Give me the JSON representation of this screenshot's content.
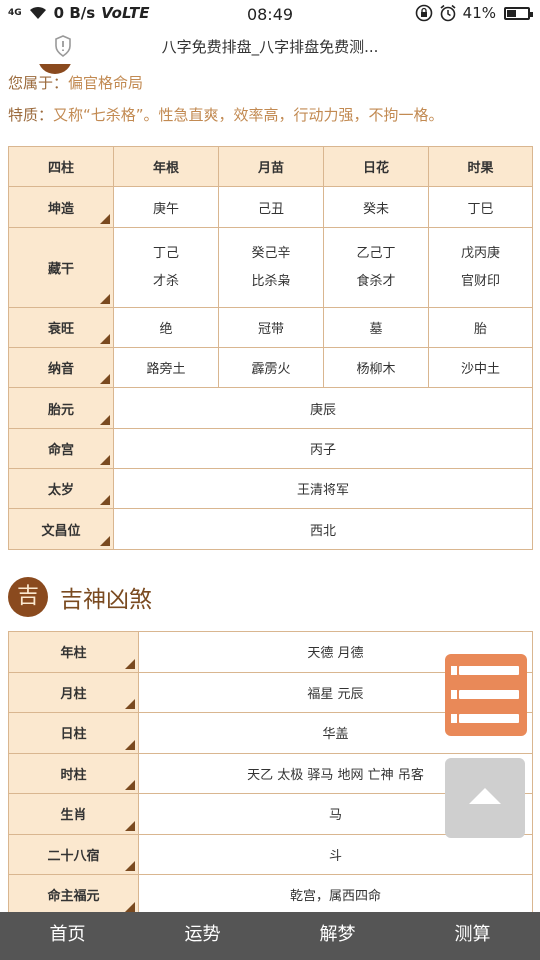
{
  "status_bar": {
    "signal": "4G",
    "speed": "0 B/s",
    "volte": "VoLTE",
    "time": "08:49",
    "battery": "41%",
    "battery_level": 0.41
  },
  "browser": {
    "title": "八字免费排盘_八字排盘免费测..."
  },
  "summary": {
    "belong_label": "您属于：",
    "belong_value": "偏官格命局",
    "trait_label": "特质：",
    "trait_value": "又称“七杀格”。性急直爽，效率高，行动力强，不拘一格。"
  },
  "bazi_table": {
    "headers": [
      "四柱",
      "年根",
      "月苗",
      "日花",
      "时果"
    ],
    "rows": [
      {
        "label": "坤造",
        "cells": [
          [
            "庚午"
          ],
          [
            "己丑"
          ],
          [
            "癸未"
          ],
          [
            "丁巳"
          ]
        ]
      },
      {
        "label": "藏干",
        "cells": [
          [
            "丁己",
            "才杀"
          ],
          [
            "癸己辛",
            "比杀枭"
          ],
          [
            "乙己丁",
            "食杀才"
          ],
          [
            "戊丙庚",
            "官财印"
          ]
        ]
      },
      {
        "label": "衰旺",
        "cells": [
          [
            "绝"
          ],
          [
            "冠带"
          ],
          [
            "墓"
          ],
          [
            "胎"
          ]
        ]
      },
      {
        "label": "纳音",
        "cells": [
          [
            "路旁土"
          ],
          [
            "霹雳火"
          ],
          [
            "杨柳木"
          ],
          [
            "沙中土"
          ]
        ]
      }
    ],
    "merged_rows": [
      {
        "label": "胎元",
        "value": "庚辰"
      },
      {
        "label": "命宫",
        "value": "丙子"
      },
      {
        "label": "太岁",
        "value": "王清将军"
      },
      {
        "label": "文昌位",
        "value": "西北"
      }
    ]
  },
  "section": {
    "icon_char": "吉",
    "title": "吉神凶煞"
  },
  "shensha_table": [
    {
      "label": "年柱",
      "value": "天德 月德"
    },
    {
      "label": "月柱",
      "value": "福星 元辰"
    },
    {
      "label": "日柱",
      "value": "华盖"
    },
    {
      "label": "时柱",
      "value": "天乙 太极 驿马 地网 亡神 吊客"
    },
    {
      "label": "生肖",
      "value": "马"
    },
    {
      "label": "二十八宿",
      "value": "斗"
    },
    {
      "label": "命主福元",
      "value": "乾宫，属西四命"
    }
  ],
  "bottom_nav": [
    "首页",
    "运势",
    "解梦",
    "测算"
  ]
}
